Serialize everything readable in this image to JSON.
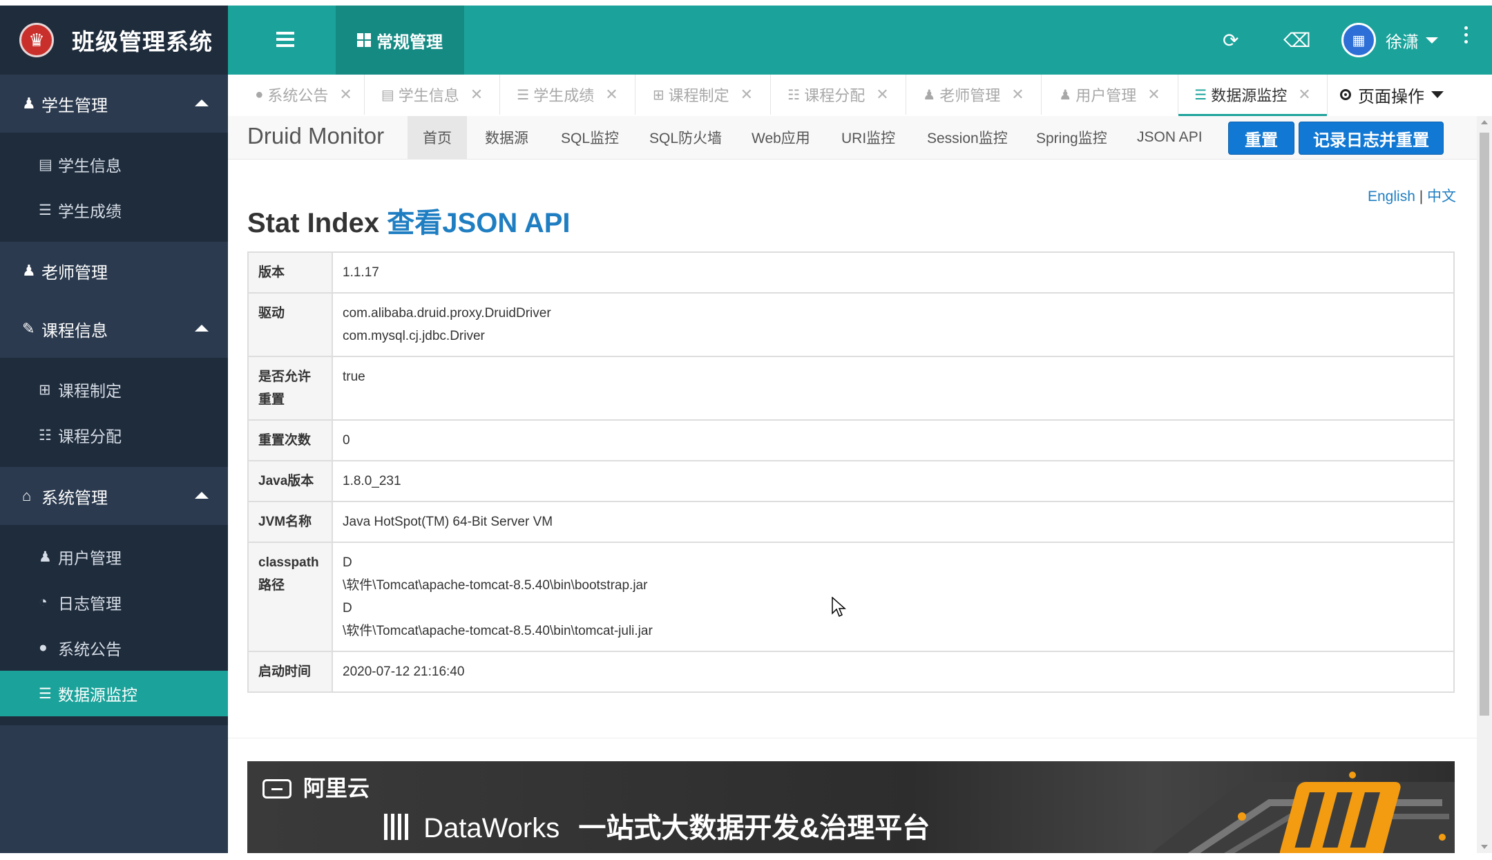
{
  "sidebar": {
    "brand_title": "班级管理系统",
    "groups": [
      {
        "label": "学生管理",
        "icon": "male-icon",
        "items": [
          {
            "label": "学生信息",
            "icon": "id-card-icon"
          },
          {
            "label": "学生成绩",
            "icon": "list-icon"
          }
        ]
      },
      {
        "label": "老师管理",
        "icon": "user-icon",
        "items": []
      },
      {
        "label": "课程信息",
        "icon": "edit-icon",
        "items": [
          {
            "label": "课程制定",
            "icon": "plus-square-icon"
          },
          {
            "label": "课程分配",
            "icon": "sitemap-icon"
          }
        ]
      },
      {
        "label": "系统管理",
        "icon": "home-icon",
        "items": [
          {
            "label": "用户管理",
            "icon": "users-icon"
          },
          {
            "label": "日志管理",
            "icon": "pie-chart-icon"
          },
          {
            "label": "系统公告",
            "icon": "comment-icon"
          },
          {
            "label": "数据源监控",
            "icon": "database-icon",
            "active": true
          }
        ]
      }
    ]
  },
  "topbar": {
    "module_tab": "常规管理",
    "user_name": "徐潇"
  },
  "tabs": [
    {
      "label": "系统公告",
      "icon": "comment-icon"
    },
    {
      "label": "学生信息",
      "icon": "id-card-icon"
    },
    {
      "label": "学生成绩",
      "icon": "list-icon"
    },
    {
      "label": "课程制定",
      "icon": "plus-square-icon"
    },
    {
      "label": "课程分配",
      "icon": "sitemap-icon"
    },
    {
      "label": "老师管理",
      "icon": "user-icon"
    },
    {
      "label": "用户管理",
      "icon": "users-icon"
    },
    {
      "label": "数据源监控",
      "icon": "database-icon",
      "active": true
    }
  ],
  "page_ops_label": "页面操作",
  "druid": {
    "brand": "Druid Monitor",
    "nav": [
      "首页",
      "数据源",
      "SQL监控",
      "SQL防火墙",
      "Web应用",
      "URI监控",
      "Session监控",
      "Spring监控",
      "JSON API"
    ],
    "reset_button": "重置",
    "log_reset_button": "记录日志并重置",
    "lang_en": "English",
    "lang_sep": "|",
    "lang_zh": "中文",
    "stat_title": "Stat Index",
    "json_api_link": "查看JSON API",
    "rows": [
      {
        "key": "版本",
        "values": [
          "1.1.17"
        ]
      },
      {
        "key": "驱动",
        "values": [
          "com.alibaba.druid.proxy.DruidDriver",
          "com.mysql.cj.jdbc.Driver"
        ]
      },
      {
        "key": "是否允许重置",
        "values": [
          "true"
        ]
      },
      {
        "key": "重置次数",
        "values": [
          "0"
        ]
      },
      {
        "key": "Java版本",
        "values": [
          "1.8.0_231"
        ]
      },
      {
        "key": "JVM名称",
        "values": [
          "Java HotSpot(TM) 64-Bit Server VM"
        ]
      },
      {
        "key": "classpath路径",
        "values": [
          "D",
          "\\软件\\Tomcat\\apache-tomcat-8.5.40\\bin\\bootstrap.jar",
          "D",
          "\\软件\\Tomcat\\apache-tomcat-8.5.40\\bin\\tomcat-juli.jar"
        ]
      },
      {
        "key": "启动时间",
        "values": [
          "2020-07-12 21:16:40"
        ]
      }
    ]
  },
  "banner": {
    "vendor": "阿里云",
    "product": "DataWorks",
    "slogan": "一站式大数据开发&治理平台"
  },
  "colors": {
    "teal": "#1ba39b",
    "sidebar_bg": "#2b3a4f",
    "button_blue": "#1178d3",
    "link_blue": "#1f7ec2"
  }
}
